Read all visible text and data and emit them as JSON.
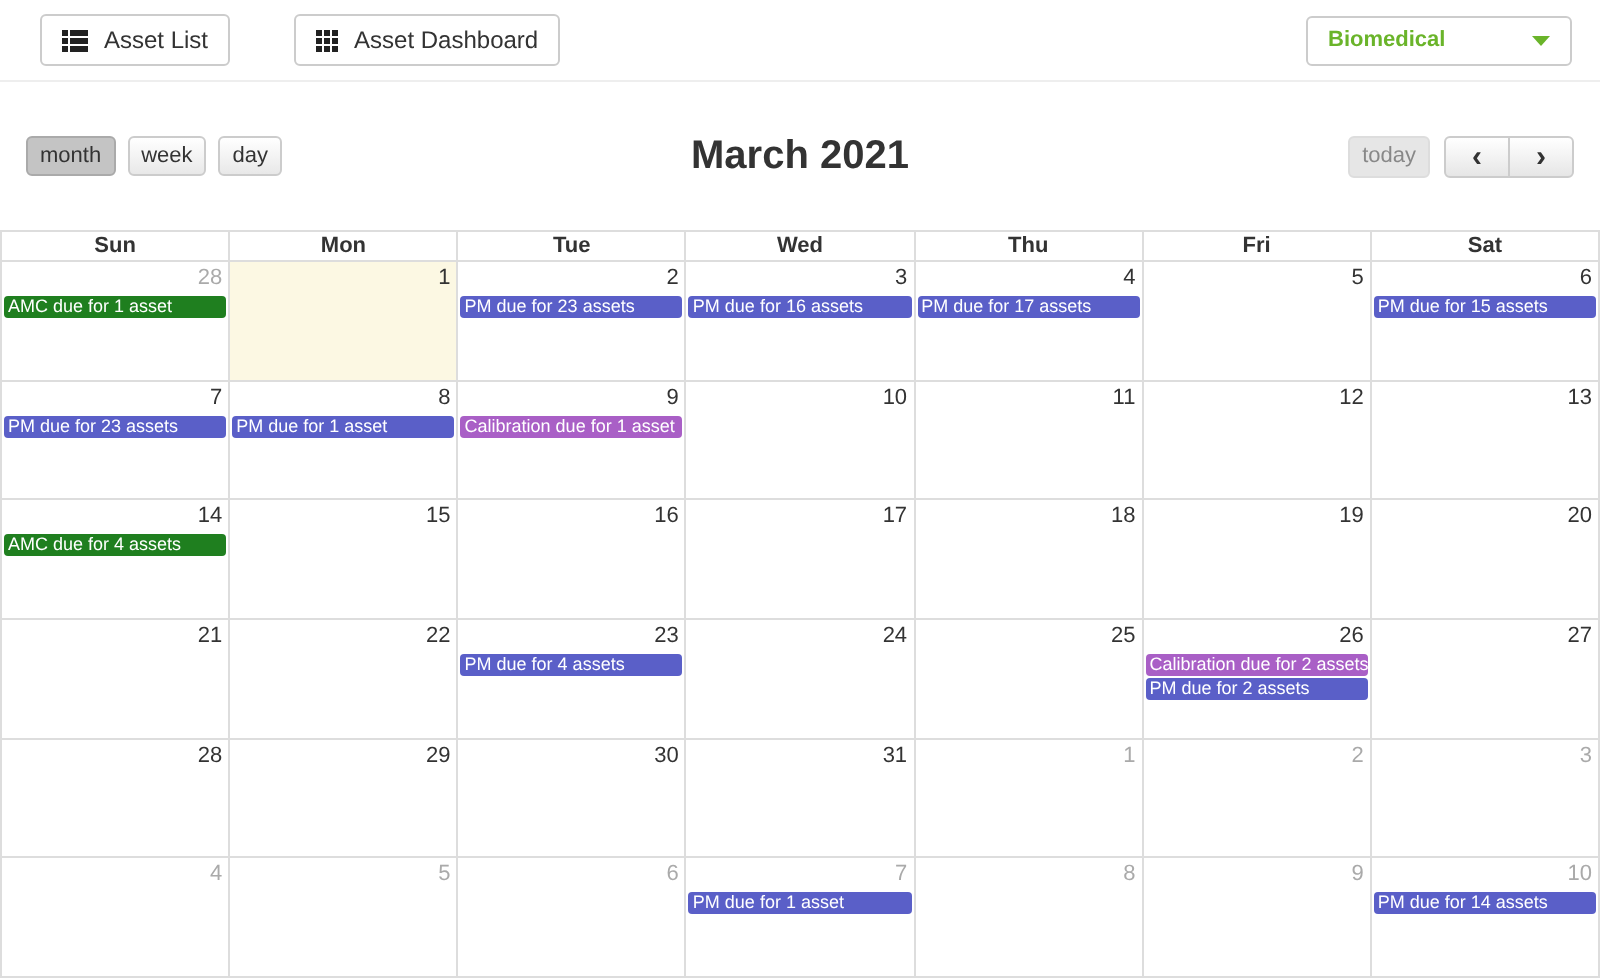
{
  "top_bar": {
    "buttons": [
      {
        "label": "Asset List",
        "kind": "list"
      },
      {
        "label": "Asset Dashboard",
        "kind": "grid"
      }
    ],
    "category_select": {
      "value": "Biomedical"
    }
  },
  "toolbar": {
    "views": [
      {
        "label": "month",
        "selected": true
      },
      {
        "label": "week",
        "selected": false
      },
      {
        "label": "day",
        "selected": false
      }
    ],
    "title": "March 2021",
    "today": {
      "label": "today",
      "disabled": true
    },
    "nav": [
      {
        "label": "‹",
        "kind": "prev"
      },
      {
        "label": "›",
        "kind": "next"
      }
    ]
  },
  "calendar": {
    "weekdays": [
      "Sun",
      "Mon",
      "Tue",
      "Wed",
      "Thu",
      "Fri",
      "Sat"
    ],
    "weeks": [
      [
        {
          "day": "28",
          "other_month": true,
          "today": false,
          "events": [
            {
              "title": "AMC due for 1 asset",
              "color": "#1f7f1f"
            }
          ]
        },
        {
          "day": "1",
          "other_month": false,
          "today": true
        },
        {
          "day": "2",
          "other_month": false,
          "today": false,
          "events": [
            {
              "title": "PM due for 23 assets",
              "color": "#5a5fc8"
            }
          ]
        },
        {
          "day": "3",
          "other_month": false,
          "today": false,
          "events": [
            {
              "title": "PM due for 16 assets",
              "color": "#5a5fc8"
            }
          ]
        },
        {
          "day": "4",
          "other_month": false,
          "today": false,
          "events": [
            {
              "title": "PM due for 17 assets",
              "color": "#5a5fc8"
            }
          ]
        },
        {
          "day": "5",
          "other_month": false,
          "today": false
        },
        {
          "day": "6",
          "other_month": false,
          "today": false,
          "events": [
            {
              "title": "PM due for 15 assets",
              "color": "#5a5fc8"
            }
          ]
        }
      ],
      [
        {
          "day": "7",
          "other_month": false,
          "today": false,
          "events": [
            {
              "title": "PM due for 23 assets",
              "color": "#5a5fc8"
            }
          ]
        },
        {
          "day": "8",
          "other_month": false,
          "today": false,
          "events": [
            {
              "title": "PM due for 1 asset",
              "color": "#5a5fc8"
            }
          ]
        },
        {
          "day": "9",
          "other_month": false,
          "today": false,
          "events": [
            {
              "title": "Calibration due for 1 asset",
              "color": "#a95fc6"
            }
          ]
        },
        {
          "day": "10",
          "other_month": false,
          "today": false
        },
        {
          "day": "11",
          "other_month": false,
          "today": false
        },
        {
          "day": "12",
          "other_month": false,
          "today": false
        },
        {
          "day": "13",
          "other_month": false,
          "today": false
        }
      ],
      [
        {
          "day": "14",
          "other_month": false,
          "today": false,
          "events": [
            {
              "title": "AMC due for 4 assets",
              "color": "#1f7f1f"
            }
          ]
        },
        {
          "day": "15",
          "other_month": false,
          "today": false
        },
        {
          "day": "16",
          "other_month": false,
          "today": false
        },
        {
          "day": "17",
          "other_month": false,
          "today": false
        },
        {
          "day": "18",
          "other_month": false,
          "today": false
        },
        {
          "day": "19",
          "other_month": false,
          "today": false
        },
        {
          "day": "20",
          "other_month": false,
          "today": false
        }
      ],
      [
        {
          "day": "21",
          "other_month": false,
          "today": false
        },
        {
          "day": "22",
          "other_month": false,
          "today": false
        },
        {
          "day": "23",
          "other_month": false,
          "today": false,
          "events": [
            {
              "title": "PM due for 4 assets",
              "color": "#5a5fc8"
            }
          ]
        },
        {
          "day": "24",
          "other_month": false,
          "today": false
        },
        {
          "day": "25",
          "other_month": false,
          "today": false
        },
        {
          "day": "26",
          "other_month": false,
          "today": false,
          "events": [
            {
              "title": "Calibration due for 2 assets",
              "color": "#a95fc6"
            },
            {
              "title": "PM due for 2 assets",
              "color": "#5a5fc8"
            }
          ]
        },
        {
          "day": "27",
          "other_month": false,
          "today": false
        }
      ],
      [
        {
          "day": "28",
          "other_month": false,
          "today": false
        },
        {
          "day": "29",
          "other_month": false,
          "today": false
        },
        {
          "day": "30",
          "other_month": false,
          "today": false
        },
        {
          "day": "31",
          "other_month": false,
          "today": false
        },
        {
          "day": "1",
          "other_month": true,
          "today": false
        },
        {
          "day": "2",
          "other_month": true,
          "today": false
        },
        {
          "day": "3",
          "other_month": true,
          "today": false
        }
      ],
      [
        {
          "day": "4",
          "other_month": true,
          "today": false
        },
        {
          "day": "5",
          "other_month": true,
          "today": false
        },
        {
          "day": "6",
          "other_month": true,
          "today": false
        },
        {
          "day": "7",
          "other_month": true,
          "today": false,
          "events": [
            {
              "title": "PM due for 1 asset",
              "color": "#5a5fc8"
            }
          ]
        },
        {
          "day": "8",
          "other_month": true,
          "today": false
        },
        {
          "day": "9",
          "other_month": true,
          "today": false
        },
        {
          "day": "10",
          "other_month": true,
          "today": false,
          "events": [
            {
              "title": "PM due for 14 assets",
              "color": "#5a5fc8"
            }
          ]
        }
      ]
    ]
  }
}
